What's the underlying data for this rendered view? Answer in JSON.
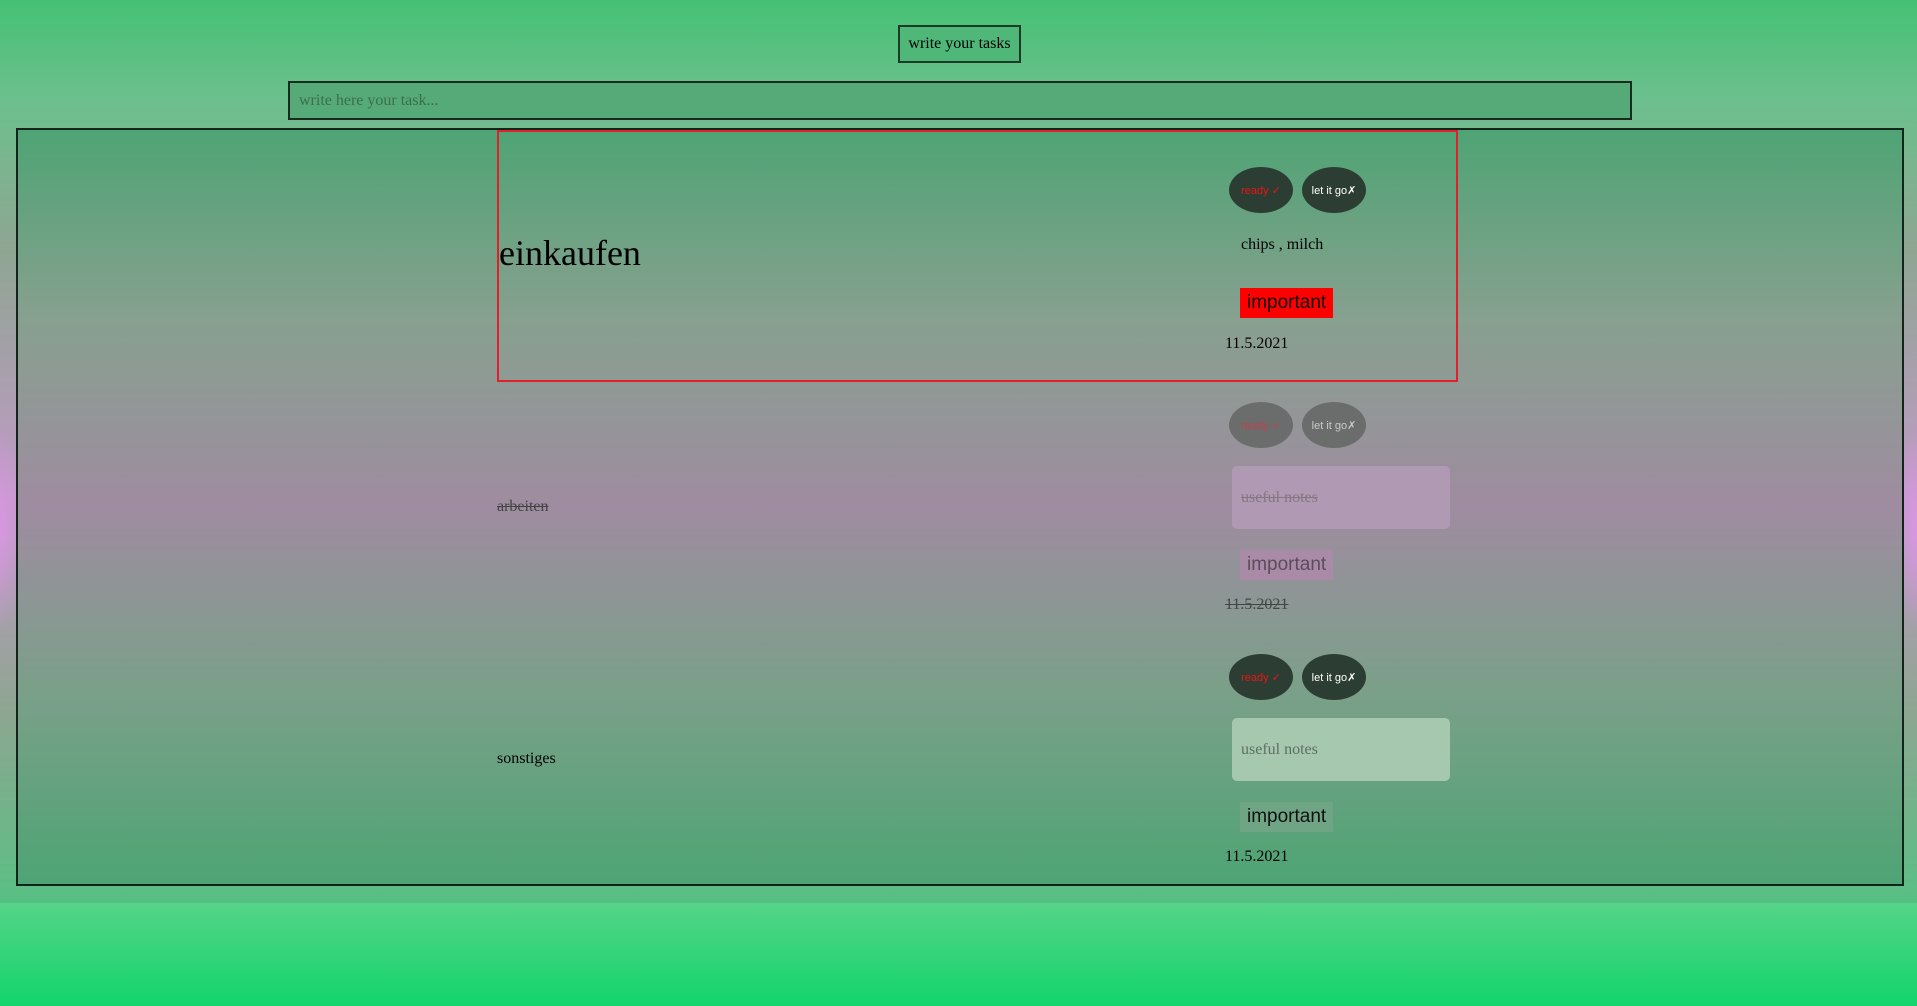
{
  "header": {
    "title_button": "write your tasks"
  },
  "input": {
    "placeholder": "write here your task..."
  },
  "tasks": [
    {
      "name": "einkaufen",
      "done_label": "ready ✓",
      "drop_label": "let it go✗",
      "notes_text": "chips , milch",
      "important_label": "important",
      "important_active": true,
      "date": "11.5.2021",
      "completed": false,
      "selected": true
    },
    {
      "name": "arbeiten",
      "done_label": "ready ✓",
      "drop_label": "let it go✗",
      "notes_placeholder": "useful notes",
      "important_label": "important",
      "important_active": false,
      "date": "11.5.2021",
      "completed": true,
      "selected": false
    },
    {
      "name": "sonstiges",
      "done_label": "ready ✓",
      "drop_label": "let it go✗",
      "notes_placeholder": "useful notes",
      "important_label": "important",
      "important_active": false,
      "date": "11.5.2021",
      "completed": false,
      "selected": false
    }
  ],
  "colors": {
    "accent_green": "#45c174",
    "important_red": "#ff0000",
    "highlight_border": "#e0202a",
    "button_dark": "#2c3e33"
  }
}
